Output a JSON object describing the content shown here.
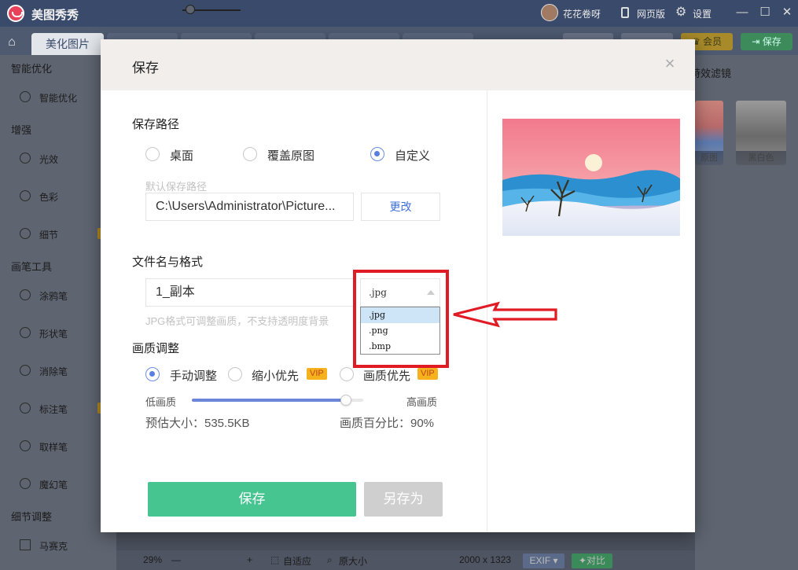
{
  "app": {
    "title": "美图秀秀",
    "user_name": "花花卷呀",
    "web_version_label": "网页版",
    "settings_label": "设置"
  },
  "tabs": {
    "active_label": "美化图片",
    "member_button": "会员",
    "save_button": "保存"
  },
  "left_panel": {
    "sections": [
      {
        "title": "智能优化",
        "items": [
          {
            "label": "智能优化",
            "icon": "sparkle-icon"
          }
        ]
      },
      {
        "title": "增强",
        "items": [
          {
            "label": "光效",
            "icon": "sun-icon"
          },
          {
            "label": "色彩",
            "icon": "palette-icon"
          },
          {
            "label": "细节",
            "icon": "magnifier-icon"
          }
        ]
      },
      {
        "title": "画笔工具",
        "items": [
          {
            "label": "涂鸦笔",
            "icon": "brush-icon"
          },
          {
            "label": "形状笔",
            "icon": "shape-icon"
          },
          {
            "label": "消除笔",
            "icon": "eraser-icon"
          },
          {
            "label": "标注笔",
            "icon": "marker-icon"
          },
          {
            "label": "取样笔",
            "icon": "eyedropper-icon"
          },
          {
            "label": "魔幻笔",
            "icon": "magic-wand-icon"
          }
        ]
      },
      {
        "title": "细节调整",
        "items": [
          {
            "label": "马赛克",
            "icon": "mosaic-icon"
          }
        ]
      }
    ]
  },
  "right_panel": {
    "title": "特效滤镜",
    "thumbnails": [
      {
        "label": "原图"
      },
      {
        "label": "黑白色"
      }
    ]
  },
  "status_bar": {
    "zoom": "29%",
    "fit_label": "自适应",
    "original_size_label": "原大小",
    "dimensions": "2000 x 1323",
    "exif_label": "EXIF",
    "compare_label": "对比"
  },
  "dialog": {
    "title": "保存",
    "path_section": {
      "title": "保存路径",
      "options": [
        {
          "label": "桌面",
          "selected": false
        },
        {
          "label": "覆盖原图",
          "selected": false
        },
        {
          "label": "自定义",
          "selected": true
        }
      ],
      "default_path_hint": "默认保存路径",
      "path_value": "C:\\Users\\Administrator\\Picture...",
      "change_button": "更改"
    },
    "file_section": {
      "title": "文件名与格式",
      "filename": "1_副本",
      "format_selected": ".jpg",
      "format_options": [
        ".jpg",
        ".png",
        ".bmp"
      ],
      "format_hint": "JPG格式可调整画质，不支持透明度背景"
    },
    "quality_section": {
      "title": "画质调整",
      "options": [
        {
          "label": "手动调整",
          "selected": true,
          "vip": false
        },
        {
          "label": "缩小优先",
          "selected": false,
          "vip": true
        },
        {
          "label": "画质优先",
          "selected": false,
          "vip": true
        }
      ],
      "vip_label": "VIP",
      "low_label": "低画质",
      "high_label": "高画质",
      "estimated_size": "预估大小：535.5KB",
      "quality_percent_text": "画质百分比：90%",
      "quality_value": 0.9
    },
    "buttons": {
      "save": "保存",
      "save_as": "另存为"
    }
  },
  "colors": {
    "accent_blue": "#5b7fe0",
    "save_green": "#46c591",
    "vip_orange": "#f5b21c",
    "annotation_red": "#e01b24"
  }
}
